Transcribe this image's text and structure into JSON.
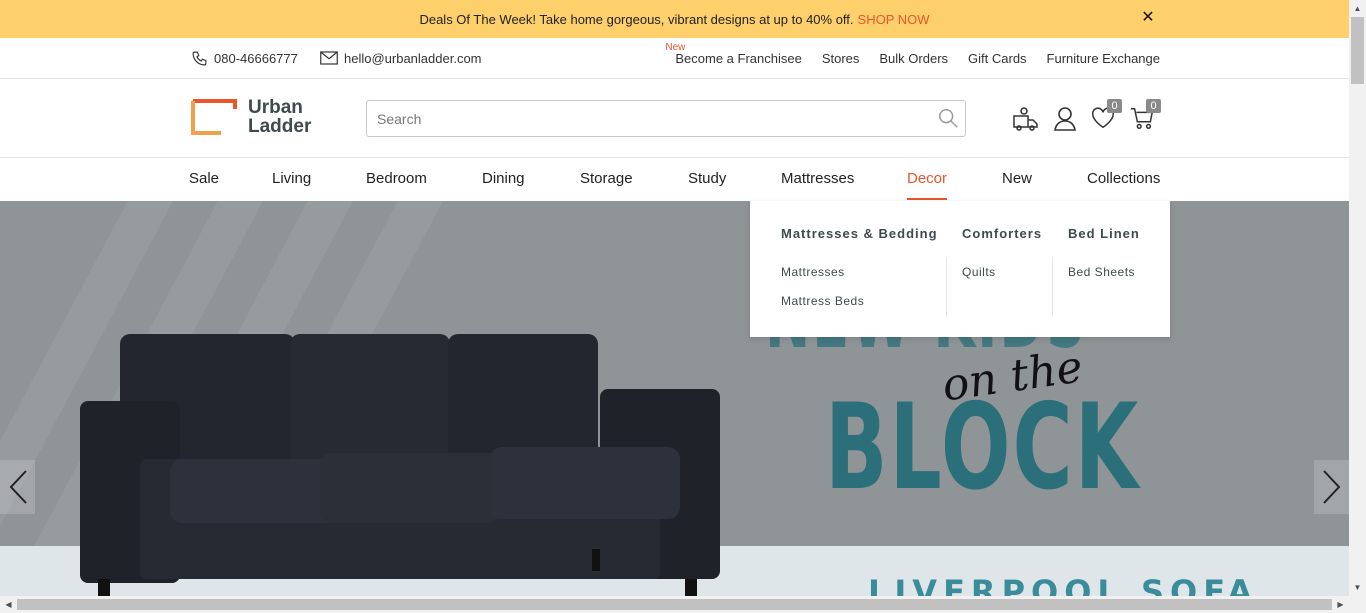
{
  "promo": {
    "text": "Deals Of The Week! Take home gorgeous, vibrant designs at up to 40% off.",
    "cta": "SHOP NOW",
    "close_symbol": "✕"
  },
  "topbar": {
    "phone": "080-46666777",
    "email": "hello@urbanladder.com",
    "new_tag": "New",
    "links": [
      "Become a Franchisee",
      "Stores",
      "Bulk Orders",
      "Gift Cards",
      "Furniture Exchange"
    ]
  },
  "header": {
    "logo_line1": "Urban",
    "logo_line2": "Ladder",
    "search_placeholder": "Search",
    "wishlist_count": "0",
    "cart_count": "0"
  },
  "nav": {
    "items": [
      "Sale",
      "Living",
      "Bedroom",
      "Dining",
      "Storage",
      "Study",
      "Mattresses",
      "Decor",
      "New",
      "Collections"
    ],
    "active": "Decor"
  },
  "dropdown": {
    "col1_head": "Mattresses & Bedding",
    "col1_items": [
      "Mattresses",
      "Mattress Beds"
    ],
    "col2_head": "Comforters",
    "col2_items": [
      "Quilts"
    ],
    "col3_head": "Bed Linen",
    "col3_items": [
      "Bed Sheets"
    ]
  },
  "hero": {
    "line1": "NEW KIDS",
    "script": "on the",
    "line2": "BLOCK",
    "subtitle": "LIVERPOOL SOFA"
  },
  "colors": {
    "accent": "#e8562a",
    "promo_bg": "#fdd06b",
    "hero_text": "#2b6f7a"
  }
}
